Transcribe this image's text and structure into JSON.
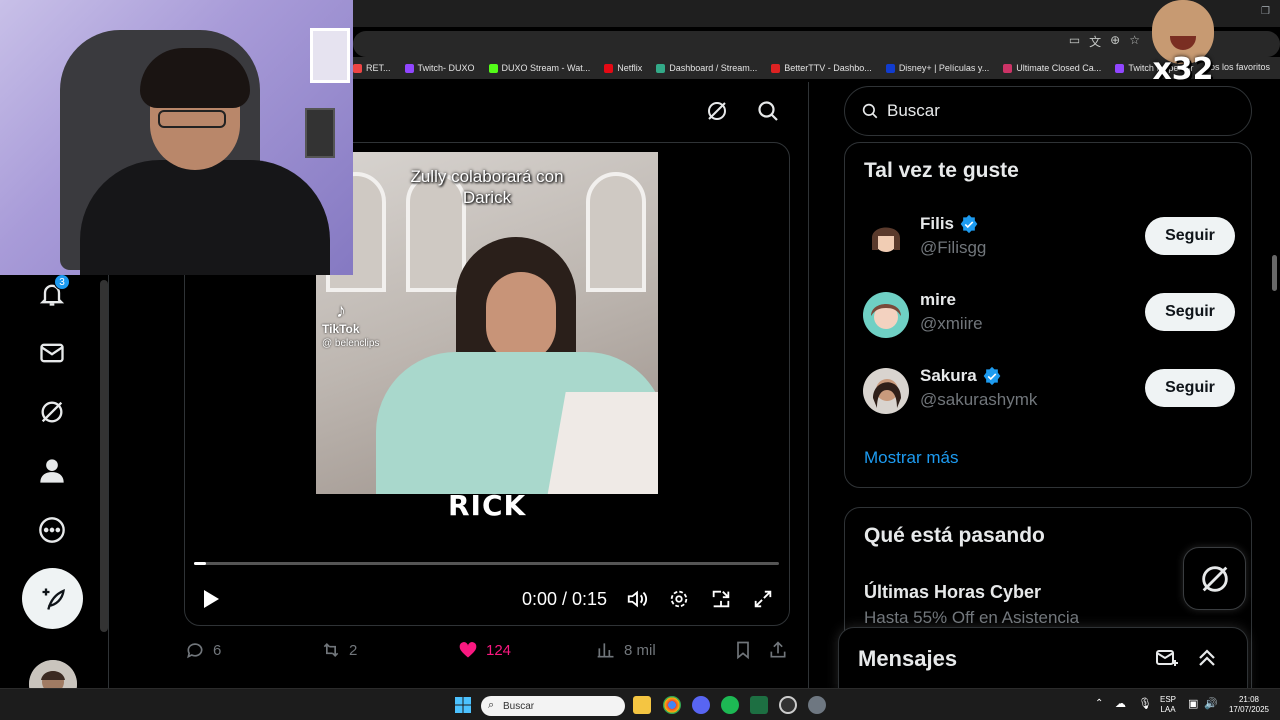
{
  "browser": {
    "bookmarks": [
      {
        "label": "RET...",
        "color": "#e44"
      },
      {
        "label": "Twitch- DUXO",
        "color": "#9146ff"
      },
      {
        "label": "DUXO Stream - Wat...",
        "color": "#53fc18"
      },
      {
        "label": "Netflix",
        "color": "#e50914"
      },
      {
        "label": "Dashboard / Stream...",
        "color": "#3a8"
      },
      {
        "label": "BetterTTV - Dashbo...",
        "color": "#d22"
      },
      {
        "label": "Disney+ | Películas y...",
        "color": "#113ccf"
      },
      {
        "label": "Ultimate Closed Ca...",
        "color": "#c36"
      },
      {
        "label": "Twitch Inspector",
        "color": "#9146ff"
      }
    ],
    "bookmarks_end": "os los favoritos"
  },
  "overlay": {
    "reaction_text": "x32"
  },
  "nav": {
    "notifications_badge": "3"
  },
  "video": {
    "caption": "Zully colaborará con Darick",
    "tiktok_label": "TikTok",
    "tiktok_handle": "@ belenclips",
    "overlay_text": "RICK",
    "time": "0:00 / 0:15",
    "progress": 0.02
  },
  "actions": {
    "replies": "6",
    "reposts": "2",
    "likes": "124",
    "views": "8 mil"
  },
  "search": {
    "placeholder": "Buscar"
  },
  "who_to_follow": {
    "title": "Tal vez te guste",
    "users": [
      {
        "name": "Filis",
        "handle": "@Filisgg",
        "verified": true,
        "follow_label": "Seguir"
      },
      {
        "name": "mire",
        "handle": "@xmiire",
        "verified": false,
        "follow_label": "Seguir"
      },
      {
        "name": "Sakura",
        "handle": "@sakurashymk",
        "verified": true,
        "follow_label": "Seguir"
      }
    ],
    "show_more": "Mostrar más"
  },
  "trends": {
    "title": "Qué está pasando",
    "item_title": "Últimas Horas Cyber",
    "item_sub": "Hasta 55% Off en Asistencia"
  },
  "messages": {
    "title": "Mensajes"
  },
  "taskbar": {
    "search_placeholder": "Buscar",
    "lang_line1": "ESP",
    "lang_line2": "LAA",
    "time": "21:08",
    "date": "17/07/2025"
  },
  "colors": {
    "accent": "#1d9bf0",
    "like": "#f91880",
    "background": "#000000"
  }
}
